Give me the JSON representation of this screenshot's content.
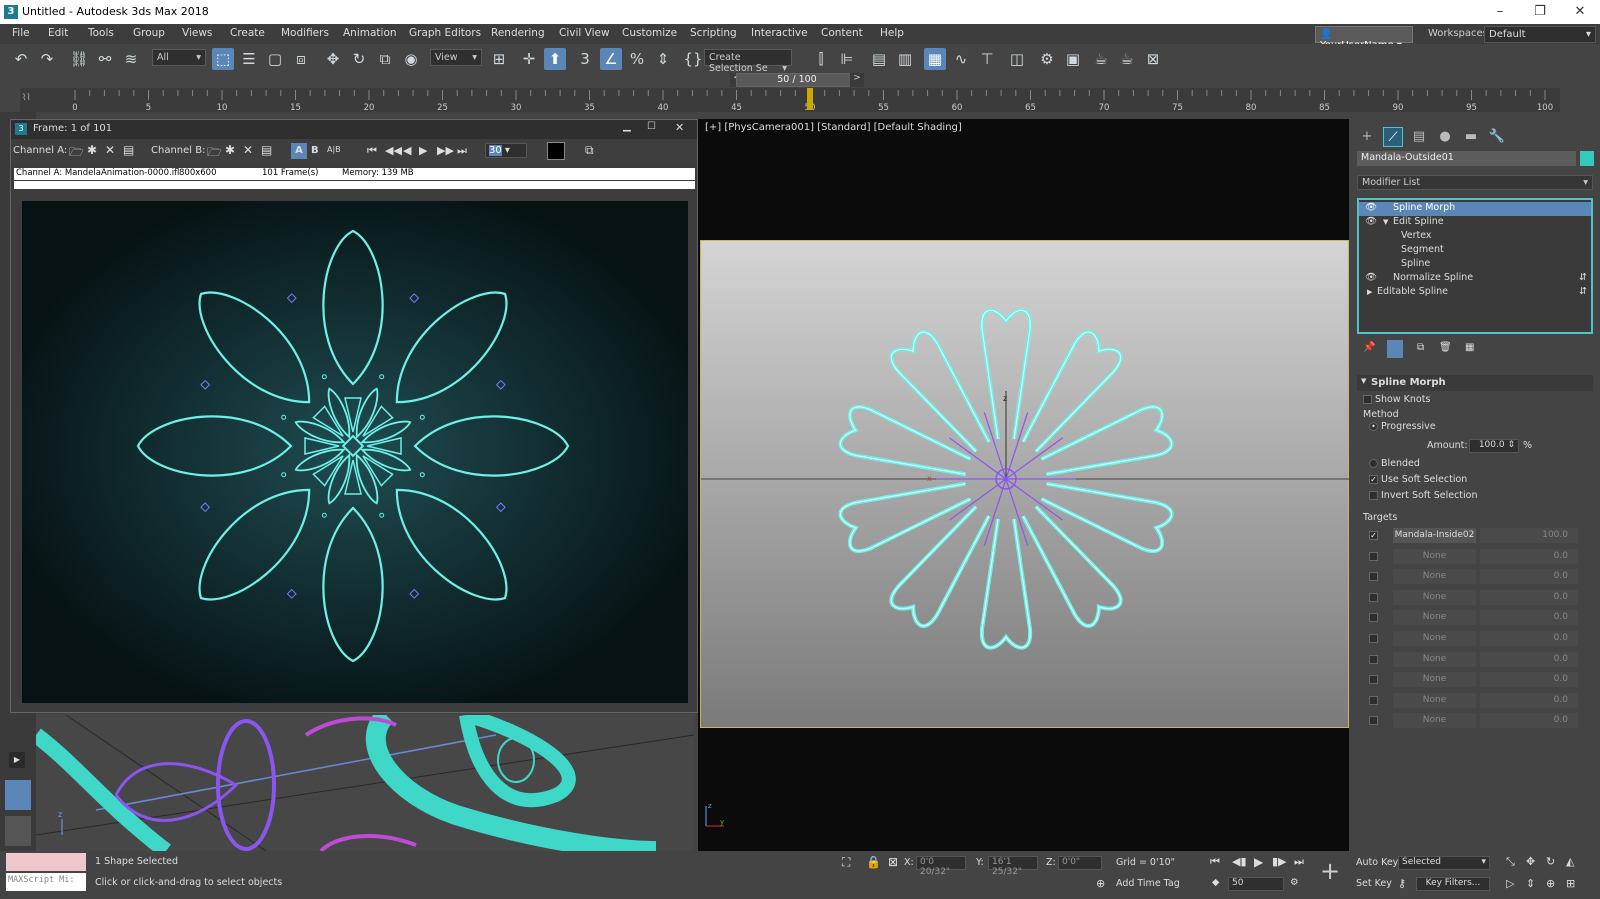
{
  "window": {
    "title": "Untitled - Autodesk 3ds Max 2018",
    "app_icon": "3"
  },
  "menu": [
    "File",
    "Edit",
    "Tools",
    "Group",
    "Views",
    "Create",
    "Modifiers",
    "Animation",
    "Graph Editors",
    "Rendering",
    "Civil View",
    "Customize",
    "Scripting",
    "Interactive",
    "Content",
    "Help"
  ],
  "user": {
    "name": "YourUserName",
    "workspaces_label": "Workspaces:",
    "workspace": "Default"
  },
  "toolbar": {
    "filter": "All",
    "refcoord": "View",
    "selset": "Create Selection Se"
  },
  "time": {
    "slider": "50 / 100",
    "ticks": [
      "0",
      "5",
      "10",
      "15",
      "20",
      "25",
      "30",
      "35",
      "40",
      "45",
      "50",
      "55",
      "60",
      "65",
      "70",
      "75",
      "80",
      "85",
      "90",
      "95",
      "100"
    ],
    "current": 50,
    "max": 100
  },
  "vfb": {
    "title": "Frame: 1 of 101",
    "channel_a": "Channel A:",
    "channel_b": "Channel B:",
    "btn_a": "A",
    "btn_b": "B",
    "btn_ab": "A|B",
    "frame": "30",
    "info": "Channel A: MandelaAnimation-0000.ifl",
    "res": "800x600",
    "frames": "101 Frame(s)",
    "memory": "Memory: 139 MB"
  },
  "viewport": {
    "label": "[+] [PhysCamera001] [Standard] [Default Shading]"
  },
  "panel": {
    "object_name": "Mandala-Outside01",
    "object_color": "#36c9b9",
    "modifier_list": "Modifier List",
    "stack": [
      {
        "label": "Spline Morph",
        "indent": 1,
        "eye": true,
        "selected": true
      },
      {
        "label": "Edit Spline",
        "indent": 1,
        "eye": true,
        "expand": true
      },
      {
        "label": "Vertex",
        "indent": 3
      },
      {
        "label": "Segment",
        "indent": 3
      },
      {
        "label": "Spline",
        "indent": 3
      },
      {
        "label": "Normalize Spline",
        "indent": 1,
        "eye": true,
        "pin": true
      },
      {
        "label": "Editable Spline",
        "indent": 0,
        "arrow": true,
        "pin": true
      }
    ],
    "rollout": "Spline Morph",
    "show_knots": "Show Knots",
    "method": "Method",
    "progressive": "Progressive",
    "amount_label": "Amount:",
    "amount": "100.0",
    "percent": "%",
    "blended": "Blended",
    "use_soft": "Use Soft Selection",
    "invert_soft": "Invert Soft Selection",
    "targets_label": "Targets",
    "targets": [
      {
        "name": "Mandala-Inside02",
        "value": "100.0",
        "checked": true
      },
      {
        "name": "None",
        "value": "0.0"
      },
      {
        "name": "None",
        "value": "0.0"
      },
      {
        "name": "None",
        "value": "0.0"
      },
      {
        "name": "None",
        "value": "0.0"
      },
      {
        "name": "None",
        "value": "0.0"
      },
      {
        "name": "None",
        "value": "0.0"
      },
      {
        "name": "None",
        "value": "0.0"
      },
      {
        "name": "None",
        "value": "0.0"
      },
      {
        "name": "None",
        "value": "0.0"
      }
    ]
  },
  "status": {
    "maxscript": "MAXScript Mi:",
    "selected": "1 Shape Selected",
    "prompt": "Click or click-and-drag to select objects",
    "x_label": "X:",
    "x": "0'0 20/32\"",
    "y_label": "Y:",
    "y": "16'1 25/32\"",
    "z_label": "Z:",
    "z": "0'0\"",
    "grid": "Grid = 0'10\"",
    "add_time_tag": "Add Time Tag",
    "auto_key": "Auto Key",
    "set_key": "Set Key",
    "selected_mode": "Selected",
    "key_filters": "Key Filters...",
    "frame": "50"
  },
  "colors": {
    "accent": "#5b87b8",
    "spline": "#6ff0e6",
    "mesh": "#3fd8c8",
    "purple": "#8b55f0"
  }
}
